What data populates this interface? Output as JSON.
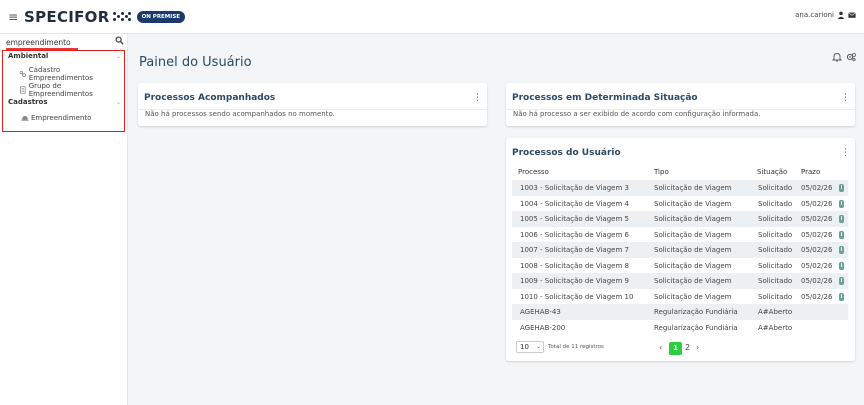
{
  "header": {
    "brand": "SPECIFOR",
    "badge": "ON PREMISE",
    "user": "ana.carioni"
  },
  "sidebar": {
    "search_value": "empreendimento",
    "sections": [
      {
        "label": "Ambiental",
        "items": [
          {
            "label": "Cadastro Empreendimentos",
            "icon": "cog-people-icon"
          },
          {
            "label": "Grupo de Empreendimentos",
            "icon": "document-icon"
          }
        ]
      },
      {
        "label": "Cadastros",
        "items": [
          {
            "label": "Empreendimento",
            "icon": "hardhat-icon"
          }
        ]
      }
    ]
  },
  "main": {
    "title": "Painel do Usuário",
    "cards": {
      "acompanhados": {
        "title": "Processos Acompanhados",
        "message": "Não há processos sendo acompanhados no momento."
      },
      "situacao": {
        "title": "Processos em Determinada Situação",
        "message": "Não há processo a ser exibido de acordo com configuração informada."
      },
      "usuario": {
        "title": "Processos do Usuário",
        "columns": [
          "Processo",
          "Tipo",
          "Situação",
          "Prazo"
        ],
        "rows": [
          {
            "processo": "1003 - Solicitação de Viagem 3",
            "tipo": "Solicitação de Viagem",
            "situacao": "Solicitado",
            "prazo": "05/02/26"
          },
          {
            "processo": "1004 - Solicitação de Viagem 4",
            "tipo": "Solicitação de Viagem",
            "situacao": "Solicitado",
            "prazo": "05/02/26"
          },
          {
            "processo": "1005 - Solicitação de Viagem 5",
            "tipo": "Solicitação de Viagem",
            "situacao": "Solicitado",
            "prazo": "05/02/26"
          },
          {
            "processo": "1006 - Solicitação de Viagem 6",
            "tipo": "Solicitação de Viagem",
            "situacao": "Solicitado",
            "prazo": "05/02/26"
          },
          {
            "processo": "1007 - Solicitação de Viagem 7",
            "tipo": "Solicitação de Viagem",
            "situacao": "Solicitado",
            "prazo": "05/02/26"
          },
          {
            "processo": "1008 - Solicitação de Viagem 8",
            "tipo": "Solicitação de Viagem",
            "situacao": "Solicitado",
            "prazo": "05/02/26"
          },
          {
            "processo": "1009 - Solicitação de Viagem 9",
            "tipo": "Solicitação de Viagem",
            "situacao": "Solicitado",
            "prazo": "05/02/26"
          },
          {
            "processo": "1010 - Solicitação de Viagem 10",
            "tipo": "Solicitação de Viagem",
            "situacao": "Solicitado",
            "prazo": "05/02/26"
          },
          {
            "processo": "AGEHAB-43",
            "tipo": "Regularização Fundiária",
            "situacao": "A#Aberto",
            "prazo": ""
          },
          {
            "processo": "AGEHAB-200",
            "tipo": "Regularização Fundiária",
            "situacao": "A#Aberto",
            "prazo": ""
          }
        ],
        "page_size": "10",
        "total_text": "Total de 11 registros",
        "pages": [
          "1",
          "2"
        ],
        "current_page": "1",
        "prev_symbol": "‹",
        "next_symbol": "›",
        "info_symbol": "i"
      }
    }
  },
  "colors": {
    "accent_green": "#2ecc40",
    "title_blue": "#2c4a66",
    "badge_navy": "#1b3a6b",
    "highlight_red": "#e01e1e",
    "info_teal": "#6aa19a"
  }
}
